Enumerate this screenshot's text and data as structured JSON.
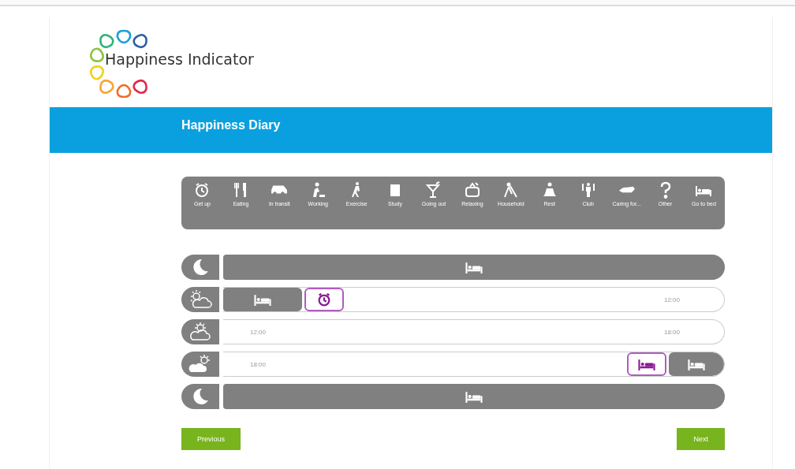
{
  "logo": {
    "text": "Happiness Indicator"
  },
  "header": {
    "title": "Happiness Diary"
  },
  "activities": [
    {
      "kind": "alarm",
      "label": "Get up"
    },
    {
      "kind": "cutlery",
      "label": "Eating"
    },
    {
      "kind": "car",
      "label": "In transit"
    },
    {
      "kind": "worker",
      "label": "Working"
    },
    {
      "kind": "walker",
      "label": "Exercise"
    },
    {
      "kind": "book",
      "label": "Study"
    },
    {
      "kind": "cocktail",
      "label": "Going out"
    },
    {
      "kind": "tv",
      "label": "Relaxing"
    },
    {
      "kind": "sweeper",
      "label": "Household"
    },
    {
      "kind": "meditate",
      "label": "Rest"
    },
    {
      "kind": "club",
      "label": "Club"
    },
    {
      "kind": "hand",
      "label": "Caring for..."
    },
    {
      "kind": "question",
      "label": "Other"
    },
    {
      "kind": "bed",
      "label": "Go to bed"
    }
  ],
  "rows": [
    {
      "kind": "night",
      "asleep": true
    },
    {
      "kind": "morning",
      "asleep": false,
      "leading": [
        {
          "kind": "sleep"
        },
        {
          "kind": "wake_up"
        }
      ],
      "end_label": "12:00"
    },
    {
      "kind": "afternoon",
      "asleep": false,
      "start_label": "12:00",
      "end_label": "18:00"
    },
    {
      "kind": "evening",
      "asleep": false,
      "start_label": "18:00",
      "trailing": [
        {
          "kind": "go_to_bed"
        },
        {
          "kind": "sleep"
        }
      ]
    },
    {
      "kind": "night",
      "asleep": true
    }
  ],
  "buttons": {
    "previous": "Previous",
    "next": "Next"
  }
}
